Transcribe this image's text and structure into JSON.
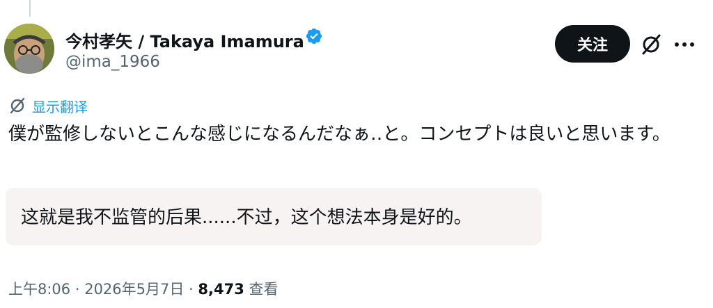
{
  "author": {
    "display_name": "今村孝矢 / Takaya Imamura",
    "handle": "@ima_1966",
    "verified": true,
    "verified_color": "#1d9bf0"
  },
  "actions": {
    "follow_label": "关注",
    "grok_icon": "grok-icon",
    "more_icon": "more-icon"
  },
  "translate": {
    "label": "显示翻译",
    "icon": "translate-icon"
  },
  "tweet": {
    "text": "僕が監修しないとこんな感じになるんだなぁ‥と。コンセプトは良いと思います。",
    "translation": "这就是我不监管的后果......不过，这个想法本身是好的。"
  },
  "meta": {
    "time": "上午8:06",
    "separator1": " · ",
    "date": "2026年5月7日",
    "separator2": " · ",
    "views_count": "8,473",
    "views_label": " 查看"
  },
  "colors": {
    "accent": "#1d9bf0",
    "text_primary": "#0f1419",
    "text_secondary": "#536471",
    "translation_bg": "#f7f3f3"
  }
}
